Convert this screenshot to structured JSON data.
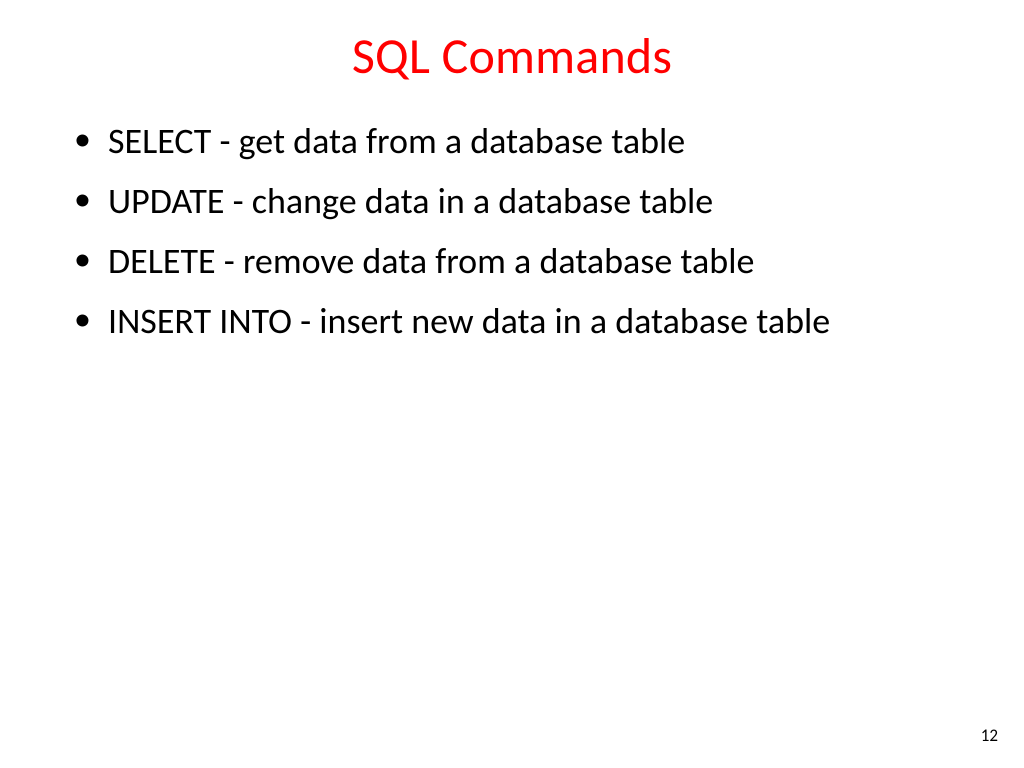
{
  "title": "SQL Commands",
  "bullets": [
    "SELECT - get data from a database table",
    "UPDATE - change data in a database table",
    "DELETE - remove data from a database table",
    "INSERT INTO - insert new data in a database table"
  ],
  "page_number": "12"
}
